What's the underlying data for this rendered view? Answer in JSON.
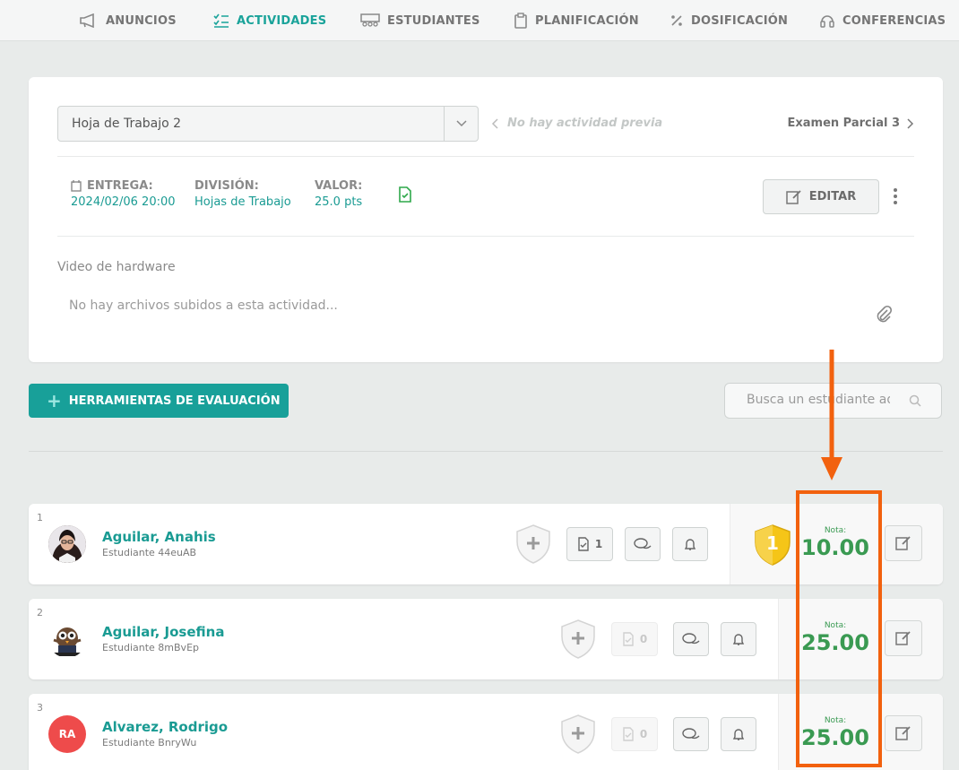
{
  "nav": {
    "items": [
      {
        "label": "ANUNCIOS",
        "icon": "megaphone-icon"
      },
      {
        "label": "ACTIVIDADES",
        "icon": "checklist-icon",
        "active": true
      },
      {
        "label": "ESTUDIANTES",
        "icon": "students-icon"
      },
      {
        "label": "PLANIFICACIÓN",
        "icon": "clipboard-icon"
      },
      {
        "label": "DOSIFICACIÓN",
        "icon": "percent-icon"
      },
      {
        "label": "CONFERENCIAS",
        "icon": "headset-icon"
      }
    ]
  },
  "activity": {
    "selected": "Hoja de Trabajo 2",
    "prev_label": "No hay actividad previa",
    "next_label": "Examen Parcial 3",
    "entrega_label": "ENTREGA:",
    "entrega_value": "2024/02/06 20:00",
    "division_label": "DIVISIÓN:",
    "division_value": "Hojas de Trabajo",
    "valor_label": "VALOR:",
    "valor_value": "25.0 pts",
    "edit_label": "EDITAR",
    "description": "Video de hardware",
    "no_files": "No hay archivos subidos a esta actividad..."
  },
  "tools": {
    "button_label": "HERRAMIENTAS DE EVALUACIÓN",
    "search_placeholder": "Busca un estudiante aquí"
  },
  "students": [
    {
      "num": "1",
      "name": "Aguilar, Anahis",
      "sub": "Estudiante 44euAB",
      "submissions": "1",
      "nota_label": "Nota:",
      "nota": "10.00",
      "rank_badge": "1"
    },
    {
      "num": "2",
      "name": "Aguilar, Josefina",
      "sub": "Estudiante 8mBvEp",
      "submissions": "0",
      "nota_label": "Nota:",
      "nota": "25.00"
    },
    {
      "num": "3",
      "name": "Alvarez, Rodrigo",
      "sub": "Estudiante BnryWu",
      "initials": "RA",
      "submissions": "0",
      "nota_label": "Nota:",
      "nota": "25.00"
    }
  ],
  "colors": {
    "accent": "#1aa39a",
    "grade": "#3a9a52",
    "annotation": "#f2610e",
    "badge_gold": "#f5c518"
  }
}
